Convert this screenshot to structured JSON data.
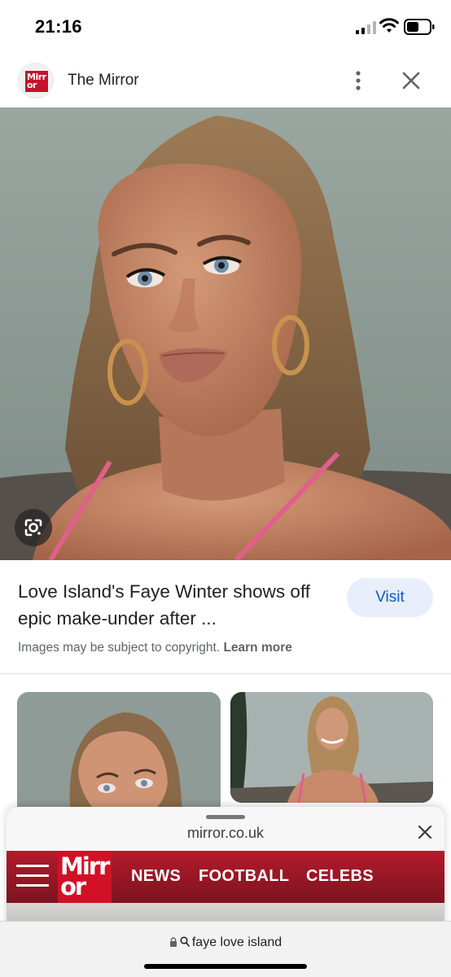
{
  "status_bar": {
    "time": "21:16"
  },
  "header": {
    "site_name": "The Mirror",
    "logo_text_top": "Mirr",
    "logo_text_bottom": "or"
  },
  "result": {
    "title": "Love Island's Faye Winter shows off epic make-under after ...",
    "visit_label": "Visit",
    "copyright_text": "Images may be subject to copyright.",
    "learn_more_label": "Learn more"
  },
  "sheet": {
    "domain": "mirror.co.uk",
    "logo_top": "Mirr",
    "logo_bottom": "or",
    "nav_items": [
      "NEWS",
      "FOOTBALL",
      "CELEBS"
    ]
  },
  "url_bar": {
    "query": "faye love island"
  },
  "icons": [
    "signal-icon",
    "wifi-icon",
    "battery-icon",
    "more-vert-icon",
    "close-icon",
    "google-lens-icon",
    "lock-icon",
    "search-icon",
    "hamburger-menu-icon"
  ],
  "colors": {
    "mirror_red": "#c7122b",
    "visit_bg": "#e8eefb",
    "visit_text": "#0b57d0"
  }
}
